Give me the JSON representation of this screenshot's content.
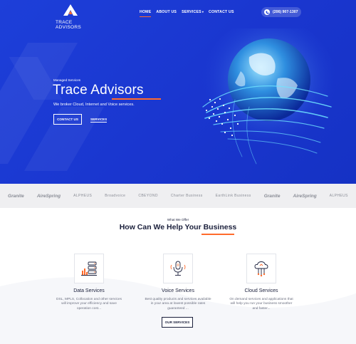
{
  "brand": {
    "name": "TRACE ADVISORS"
  },
  "nav": {
    "items": [
      {
        "label": "HOME",
        "active": true
      },
      {
        "label": "ABOUT US",
        "active": false
      },
      {
        "label": "SERVICES",
        "active": false,
        "dropdown": true
      },
      {
        "label": "CONTACT US",
        "active": false
      }
    ],
    "phone": "(206) 907-1307"
  },
  "hero": {
    "eyebrow": "Managed Services",
    "title": "Trace Advisors",
    "subtitle": "We broker Cloud, Internet and Voice services.",
    "cta_primary": "CONTACT US",
    "cta_secondary": "SERVICES"
  },
  "partners": [
    "Granite",
    "AireSpring",
    "ALPHEUS",
    "Broadvoice",
    "CBEYOND",
    "Charter Business",
    "EarthLink Business",
    "Granite",
    "AireSpring",
    "ALPHEUS"
  ],
  "services": {
    "eyebrow": "What We Offer",
    "title_prefix": "How Can We Help Your",
    "title_highlight": "Business",
    "cards": [
      {
        "icon": "data-server-icon",
        "title": "Data Services",
        "desc": "DSL, MPLS, Collocation and other services will improve your efficiency and save operation cost..."
      },
      {
        "icon": "microphone-icon",
        "title": "Voice Services",
        "desc": "Best quality products and services available in your area at lowest possible rates guaranteed ..."
      },
      {
        "icon": "cloud-icon",
        "title": "Cloud Services",
        "desc": "On demand services and applications that will help you run your business smoother and faster..."
      }
    ],
    "button": "OUR SERVICES"
  },
  "colors": {
    "hero_blue": "#1d3fd9",
    "accent": "#ff6b2c",
    "text_dark": "#1a1f3b"
  }
}
